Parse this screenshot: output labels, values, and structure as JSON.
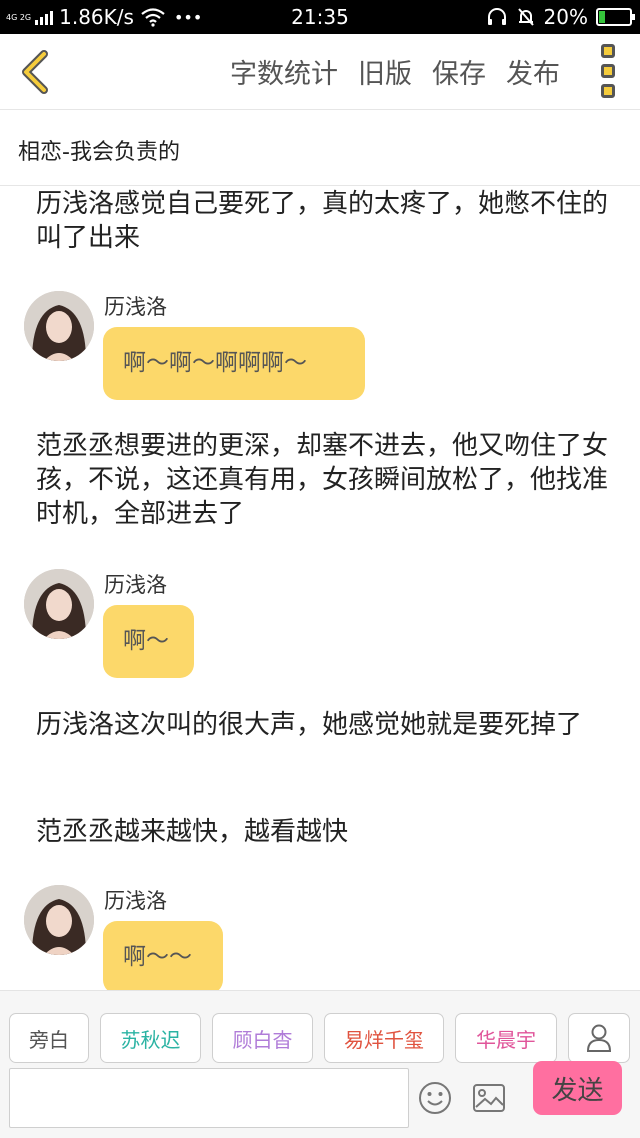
{
  "status_bar": {
    "network": "4G 2G",
    "speed": "1.86K/s",
    "dots": "•••",
    "time": "21:35",
    "battery": "20%",
    "battery_level": 0.2
  },
  "toolbar": {
    "word_count_label": "字数统计",
    "old_version_label": "旧版",
    "save_label": "保存",
    "publish_label": "发布"
  },
  "story": {
    "title": "相恋-我会负责的"
  },
  "messages": [
    {
      "type": "narration",
      "text": "历浅洛感觉自己要死了，真的太疼了，她憋不住的叫了出来"
    },
    {
      "type": "dialogue",
      "speaker": "历浅洛",
      "text": "啊～啊～啊啊啊～"
    },
    {
      "type": "narration",
      "text": "范丞丞想要进的更深，却塞不进去，他又吻住了女孩，不说，这还真有用，女孩瞬间放松了，他找准时机，全部进去了"
    },
    {
      "type": "dialogue",
      "speaker": "历浅洛",
      "text": "啊～"
    },
    {
      "type": "narration",
      "text": "历浅洛这次叫的很大声，她感觉她就是要死掉了"
    },
    {
      "type": "narration",
      "text": "范丞丞越来越快，越看越快"
    },
    {
      "type": "dialogue",
      "speaker": "历浅洛",
      "text": "啊～～"
    }
  ],
  "characters": [
    {
      "name": "旁白",
      "color": "#555555"
    },
    {
      "name": "苏秋迟",
      "color": "#2bb3a3"
    },
    {
      "name": "顾白杳",
      "color": "#b07cd8"
    },
    {
      "name": "易烊千玺",
      "color": "#e0533f"
    },
    {
      "name": "华晨宇",
      "color": "#e0559a"
    }
  ],
  "input": {
    "placeholder": ""
  },
  "send_label": "发送",
  "colors": {
    "accent_yellow": "#f5cc3c",
    "bubble": "#fcd86a",
    "send": "#ff6fa0"
  }
}
